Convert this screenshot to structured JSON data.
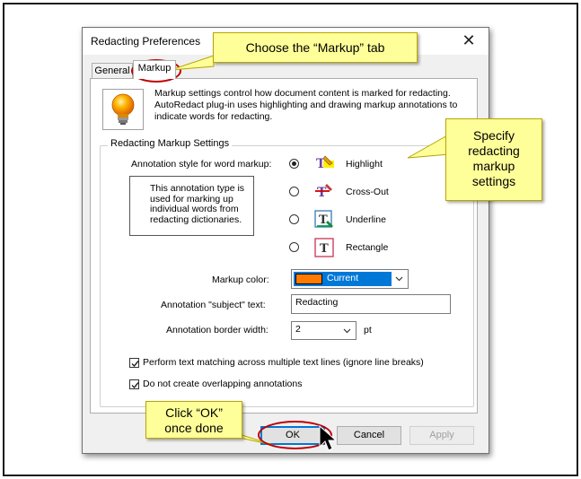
{
  "dialog": {
    "title": "Redacting Preferences",
    "close_glyph": "✕",
    "tabs": [
      {
        "label": "General"
      },
      {
        "label": "Markup"
      }
    ],
    "description": "Markup settings control how document content is marked for redacting. AutoRedact plug-in uses highlighting and drawing markup annotations to indicate words for redacting.",
    "group_label": "Redacting Markup Settings",
    "annotation_style_label": "Annotation style for word markup:",
    "info_text": "This annotation type is used for marking up individual words from redacting dictionaries.",
    "styles": [
      {
        "label": "Highlight",
        "selected": true,
        "icon": "highlight-icon"
      },
      {
        "label": "Cross-Out",
        "selected": false,
        "icon": "cross-out-icon"
      },
      {
        "label": "Underline",
        "selected": false,
        "icon": "underline-icon"
      },
      {
        "label": "Rectangle",
        "selected": false,
        "icon": "rectangle-icon"
      }
    ],
    "markup_color_label": "Markup color:",
    "markup_color_value": "Current",
    "markup_color_swatch": "#ff7a00",
    "subject_label": "Annotation \"subject\" text:",
    "subject_value": "Redacting",
    "border_width_label": "Annotation border width:",
    "border_width_value": "2",
    "border_width_unit": "pt",
    "checkboxes": [
      {
        "label": "Perform text matching across multiple text lines (ignore line breaks)",
        "checked": true
      },
      {
        "label": "Do not create overlapping annotations",
        "checked": true
      }
    ],
    "buttons": {
      "ok": "OK",
      "cancel": "Cancel",
      "apply": "Apply"
    }
  },
  "callouts": {
    "markup_tab": "Choose the “Markup” tab",
    "specify_line1": "Specify",
    "specify_line2": "redacting",
    "specify_line3": "markup",
    "specify_line4": "settings",
    "ok_line1": "Click “OK”",
    "ok_line2": "once done"
  },
  "colors": {
    "accent": "#0078d7",
    "callout": "#ffff99",
    "highlight_oval": "#c00000"
  }
}
